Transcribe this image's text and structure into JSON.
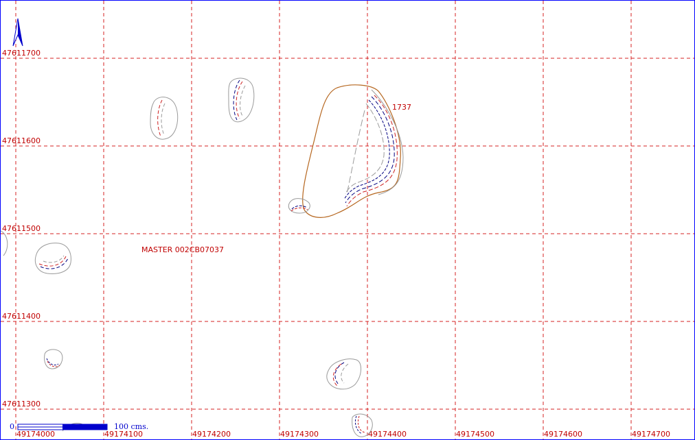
{
  "map": {
    "colors": {
      "grid": "#d42020",
      "label": "#c00000",
      "border": "#0000ff",
      "outline_brown": "#b5651d",
      "contour_gray": "#9a9a9a",
      "contour_navy": "#000080",
      "contour_red": "#cc2020",
      "scale_blue": "#0000cc"
    },
    "north_arrow_icon": "north-arrow-icon",
    "y_labels": [
      "47611700",
      "47611600",
      "47611500",
      "47611400",
      "47611300"
    ],
    "x_labels": [
      "49174000",
      "49174100",
      "49174200",
      "49174300",
      "49174400",
      "49174500",
      "49174600",
      "49174700"
    ],
    "sheet_label": "MASTER 002CB07037",
    "feature_label": "1737",
    "scale_bar": {
      "zero": "0",
      "label": "100  cms."
    }
  }
}
